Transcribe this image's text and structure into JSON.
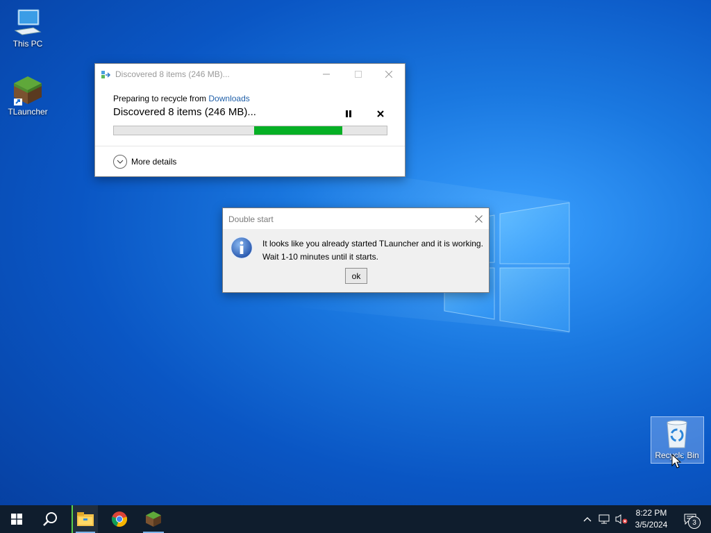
{
  "desktop": {
    "icons": [
      {
        "label": "This PC"
      },
      {
        "label": "TLauncher"
      },
      {
        "label": "Recycle Bin"
      }
    ]
  },
  "recycle_window": {
    "title": "Discovered 8 items (246 MB)...",
    "line1_prefix": "Preparing to recycle from ",
    "line1_link": "Downloads",
    "status": "Discovered 8 items (246 MB)...",
    "more_details": "More details",
    "progress_start_fraction": 0.515,
    "progress_end_fraction": 0.838,
    "progress_color": "#06b025"
  },
  "dialog": {
    "title": "Double start",
    "message_line1": "It looks like you already started TLauncher and it is working.",
    "message_line2": "Wait 1-10 minutes until it starts.",
    "ok_label": "ok"
  },
  "taskbar": {
    "items": [
      "start-icon",
      "search-icon",
      "file-explorer-icon",
      "chrome-icon",
      "minecraft-icon"
    ],
    "time": "8:22 PM",
    "date": "3/5/2024",
    "notification_count": "3"
  }
}
